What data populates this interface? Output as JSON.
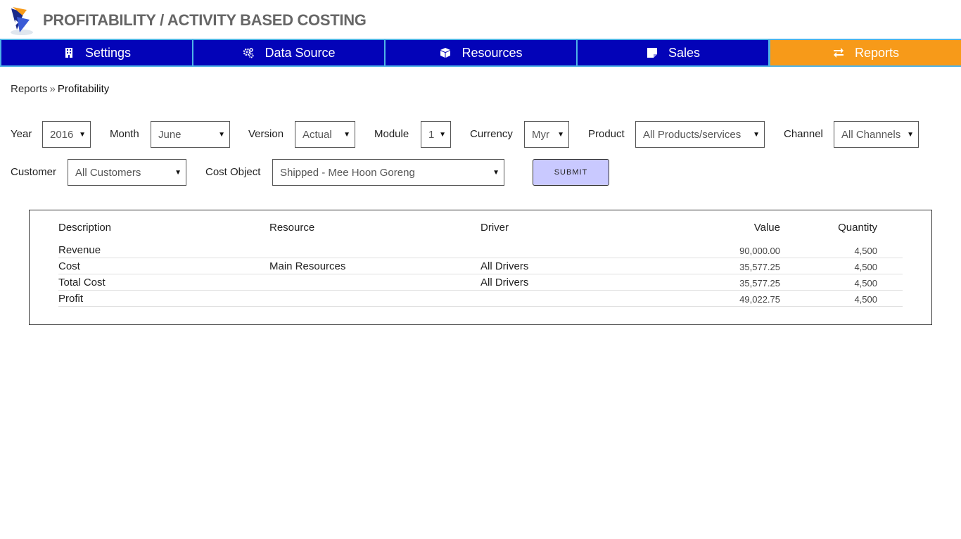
{
  "app": {
    "title": "PROFITABILITY / ACTIVITY BASED COSTING"
  },
  "nav": {
    "tabs": [
      {
        "label": "Settings",
        "icon": "building-icon"
      },
      {
        "label": "Data Source",
        "icon": "gears-icon"
      },
      {
        "label": "Resources",
        "icon": "cube-icon"
      },
      {
        "label": "Sales",
        "icon": "sticky-note-icon"
      },
      {
        "label": "Reports",
        "icon": "exchange-icon",
        "active": true
      }
    ],
    "colors": {
      "default": "#0303b8",
      "active": "#f79a19",
      "border": "#4fb3e6"
    }
  },
  "breadcrumb": {
    "parent": "Reports",
    "separator": "»",
    "current": "Profitability"
  },
  "filters": {
    "year": {
      "label": "Year",
      "value": "2016"
    },
    "month": {
      "label": "Month",
      "value": "June"
    },
    "version": {
      "label": "Version",
      "value": "Actual"
    },
    "module": {
      "label": "Module",
      "value": "1"
    },
    "currency": {
      "label": "Currency",
      "value": "Myr"
    },
    "product": {
      "label": "Product",
      "value": "All Products/services"
    },
    "channel": {
      "label": "Channel",
      "value": "All Channels"
    },
    "customer": {
      "label": "Customer",
      "value": "All Customers"
    },
    "cost_object": {
      "label": "Cost Object",
      "value": "Shipped - Mee Hoon Goreng"
    },
    "submit_label": "SUBMIT"
  },
  "report": {
    "columns": {
      "description": "Description",
      "resource": "Resource",
      "driver": "Driver",
      "value": "Value",
      "quantity": "Quantity"
    },
    "rows": [
      {
        "description": "Revenue",
        "resource": "",
        "driver": "",
        "value": "90,000.00",
        "quantity": "4,500"
      },
      {
        "description": "Cost",
        "resource": "Main Resources",
        "driver": "All Drivers",
        "value": "35,577.25",
        "quantity": "4,500"
      },
      {
        "description": "Total Cost",
        "resource": "",
        "driver": "All Drivers",
        "value": "35,577.25",
        "quantity": "4,500"
      },
      {
        "description": "Profit",
        "resource": "",
        "driver": "",
        "value": "49,022.75",
        "quantity": "4,500"
      }
    ]
  }
}
